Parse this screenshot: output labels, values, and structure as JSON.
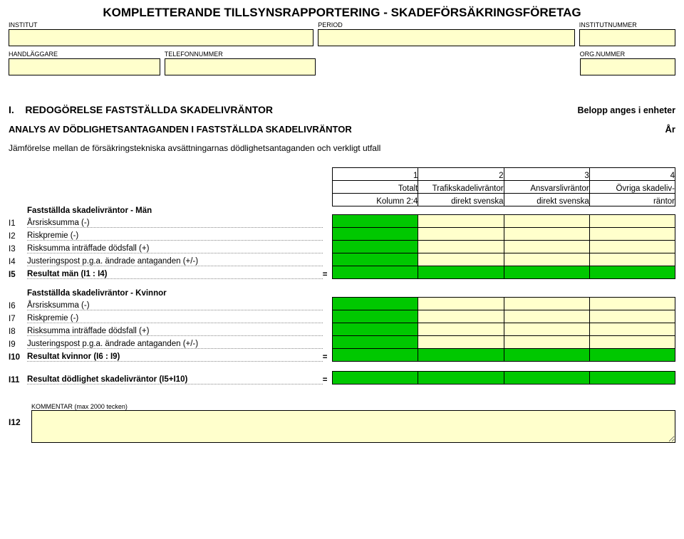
{
  "title": "KOMPLETTERANDE TILLSYNSRAPPORTERING - SKADEFÖRSÄKRINGSFÖRETAG",
  "header": {
    "institut_label": "INSTITUT",
    "institut_value": "",
    "period_label": "PERIOD",
    "period_value": "",
    "institutnummer_label": "INSTITUTNUMMER",
    "institutnummer_value": "",
    "handlaggare_label": "HANDLÄGGARE",
    "handlaggare_value": "",
    "telefon_label": "TELEFONNUMMER",
    "telefon_value": "",
    "orgnummer_label": "ORG.NUMMER",
    "orgnummer_value": ""
  },
  "section": {
    "prefix": "I.",
    "title": "REDOGÖRELSE FASTSTÄLLDA SKADELIVRÄNTOR",
    "note": "Belopp anges i enheter",
    "subtitle": "ANALYS AV DÖDLIGHETSANTAGANDEN I FASTSTÄLLDA SKADELIVRÄNTOR",
    "year_label": "År",
    "description": "Jämförelse mellan de försäkringstekniska avsättningarnas dödlighetsantaganden och verkligt utfall"
  },
  "columns": {
    "nums": [
      "1",
      "2",
      "3",
      "4"
    ],
    "h1": [
      "Totalt",
      "Trafikskadelivräntor",
      "Ansvarslivräntor",
      "Övriga skadeliv-"
    ],
    "h2": [
      "Kolumn 2:4",
      "direkt svenska",
      "direkt svenska",
      "räntor"
    ]
  },
  "groups": {
    "men_title": "Fastställda skadelivräntor - Män",
    "women_title": "Fastställda skadelivräntor - Kvinnor"
  },
  "rows": {
    "I1": {
      "code": "I1",
      "label": "Årsrisksumma (-)"
    },
    "I2": {
      "code": "I2",
      "label": "Riskpremie (-)"
    },
    "I3": {
      "code": "I3",
      "label": "Risksumma inträffade dödsfall (+)"
    },
    "I4": {
      "code": "I4",
      "label": "Justeringspost p.g.a. ändrade antaganden (+/-)"
    },
    "I5": {
      "code": "I5",
      "label": "Resultat män (I1 : I4)",
      "eq": "="
    },
    "I6": {
      "code": "I6",
      "label": "Årsrisksumma (-)"
    },
    "I7": {
      "code": "I7",
      "label": "Riskpremie (-)"
    },
    "I8": {
      "code": "I8",
      "label": "Risksumma inträffade dödsfall (+)"
    },
    "I9": {
      "code": "I9",
      "label": "Justeringspost p.g.a. ändrade antaganden (+/-)"
    },
    "I10": {
      "code": "I10",
      "label": "Resultat kvinnor (I6 : I9)",
      "eq": "="
    },
    "I11": {
      "code": "I11",
      "label": "Resultat dödlighet skadelivräntor (I5+I10)",
      "eq": "="
    }
  },
  "comment": {
    "code": "I12",
    "label": "KOMMENTAR (max 2000 tecken)"
  }
}
